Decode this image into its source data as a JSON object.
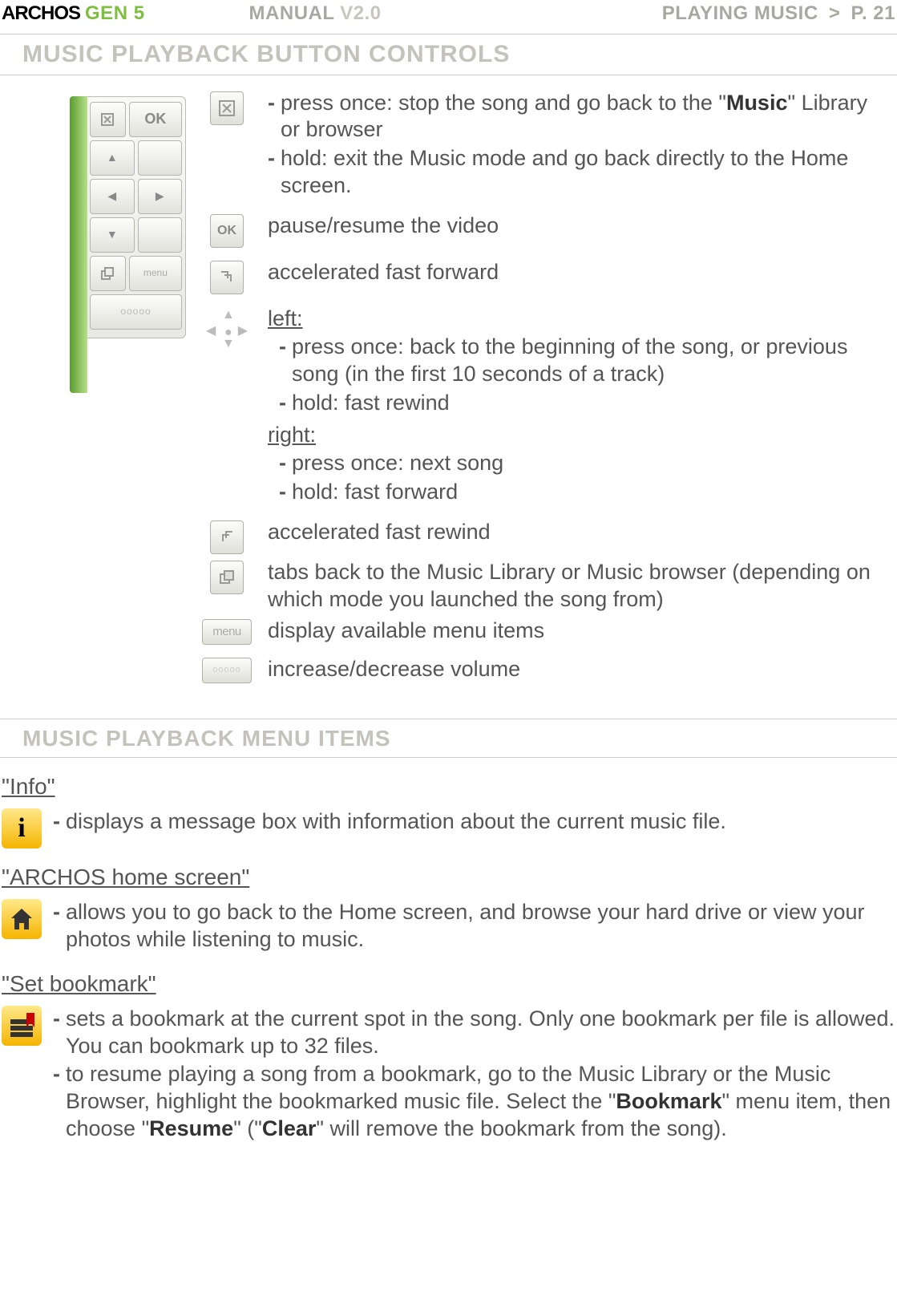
{
  "header": {
    "logo": "ARCHOS",
    "gen": "GEN 5",
    "manual": "MANUAL",
    "version": "V2.0",
    "breadcrumb": "PLAYING MUSIC",
    "gt": ">",
    "page": "P. 21"
  },
  "section1_title": "MUSIC PLAYBACK BUTTON CONTROLS",
  "device": {
    "ok": "OK",
    "menu": "menu"
  },
  "controls": {
    "close": {
      "item1_pre": "press once: stop the song and go back to the \"",
      "item1_bold": "Music",
      "item1_post": "\" Library or browser",
      "item2": "hold: exit the Music mode and go back directly to the Home screen."
    },
    "ok_label": "OK",
    "ok": "pause/resume the video",
    "ffwd": "accelerated fast forward",
    "nav": {
      "left_head": "left:",
      "left1": "press once: back to the beginning of the song, or previous  song (in the first 10 seconds of a track)",
      "left2": "hold: fast rewind",
      "right_head": "right:",
      "right1": "press once: next song",
      "right2": "hold: fast forward"
    },
    "frwd": "accelerated fast rewind",
    "tabs": "tabs back to the Music Library or Music browser (depending on which mode you launched the song from)",
    "menu_label": "menu",
    "menu": "display available menu items",
    "vol_label": "ooooo",
    "vol": "increase/decrease volume"
  },
  "section2_title": "MUSIC PLAYBACK MENU ITEMS",
  "menus": {
    "info_head": "\"Info\"",
    "info_glyph": "i",
    "info_desc": "displays a message box with information about the current music file.",
    "home_head": "\"ARCHOS home screen\"",
    "home_desc": "allows you to go back to the Home screen, and browse your hard drive or view your photos while listening to music.",
    "bm_head": "\"Set bookmark\"",
    "bm1": "sets a bookmark at the current spot in the song. Only one bookmark per file is allowed. You can bookmark up to 32 files.",
    "bm2_a": "to resume playing a song from a bookmark, go to the Music Library or the Music Browser, highlight the bookmarked music file. Select the \"",
    "bm2_b1": "Bookmark",
    "bm2_c": "\" menu item, then choose \"",
    "bm2_b2": "Resume",
    "bm2_d": "\" (\"",
    "bm2_b3": "Clear",
    "bm2_e": "\" will remove the bookmark from the song)."
  }
}
